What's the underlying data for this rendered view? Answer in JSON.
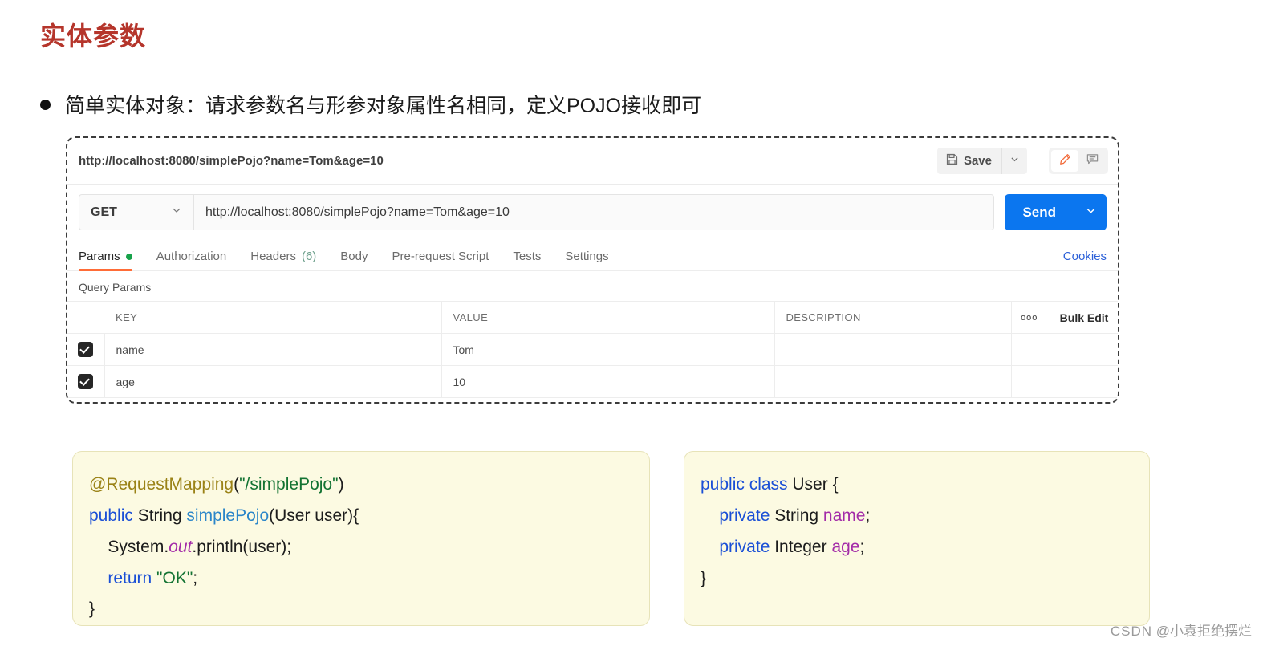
{
  "slide": {
    "title": "实体参数",
    "bullet": "简单实体对象：请求参数名与形参对象属性名相同，定义POJO接收即可"
  },
  "postman": {
    "tab_name": "http://localhost:8080/simplePojo?name=Tom&age=10",
    "save_label": "Save",
    "save_icon": "floppy-disk-icon",
    "save_caret_icon": "chevron-down-icon",
    "edit_icon": "pencil-icon",
    "comment_icon": "comment-icon",
    "method": "GET",
    "method_caret_icon": "chevron-down-icon",
    "url": "http://localhost:8080/simplePojo?name=Tom&age=10",
    "send_label": "Send",
    "send_caret_icon": "chevron-down-icon",
    "cookies_label": "Cookies",
    "tabs": [
      {
        "label": "Params",
        "dot": true,
        "active": true
      },
      {
        "label": "Authorization",
        "active": false
      },
      {
        "label": "Headers",
        "count": "(6)",
        "active": false
      },
      {
        "label": "Body",
        "active": false
      },
      {
        "label": "Pre-request Script",
        "active": false
      },
      {
        "label": "Tests",
        "active": false
      },
      {
        "label": "Settings",
        "active": false
      }
    ],
    "query_params_label": "Query Params",
    "table": {
      "headers": {
        "key": "KEY",
        "value": "VALUE",
        "description": "DESCRIPTION",
        "more": "ooo",
        "bulk_edit": "Bulk Edit"
      },
      "rows": [
        {
          "checked": true,
          "key": "name",
          "value": "Tom",
          "description": ""
        },
        {
          "checked": true,
          "key": "age",
          "value": "10",
          "description": ""
        }
      ]
    }
  },
  "code_left": {
    "line1_anno": "@RequestMapping",
    "line1_paren_open": "(",
    "line1_str": "\"/simplePojo\"",
    "line1_paren_close": ")",
    "line2_kw": "public",
    "line2_type": " String ",
    "line2_method": "simplePojo",
    "line2_args": "(User user){",
    "line3_a": "    System.",
    "line3_static": "out",
    "line3_b": ".println(user);",
    "line4_kw": "    return ",
    "line4_str": "\"OK\"",
    "line4_end": ";",
    "line5": "}"
  },
  "code_right": {
    "line1_kw": "public class ",
    "line1_name": "User {",
    "line2_kw": "    private",
    "line2_type": " String ",
    "line2_field": "name",
    "line2_end": ";",
    "line3_kw": "    private",
    "line3_type": " Integer ",
    "line3_field": "age",
    "line3_end": ";",
    "line4": "}"
  },
  "watermark": {
    "brand": "CSDN",
    "author": "@小袁拒绝摆烂"
  },
  "colors": {
    "title": "#b5352b",
    "send_blue": "#0b76ef",
    "accent_orange": "#ff6c37",
    "params_dot_green": "#17a24a",
    "cookies_blue": "#2a5fd8",
    "code_bg": "#fcfae2"
  }
}
